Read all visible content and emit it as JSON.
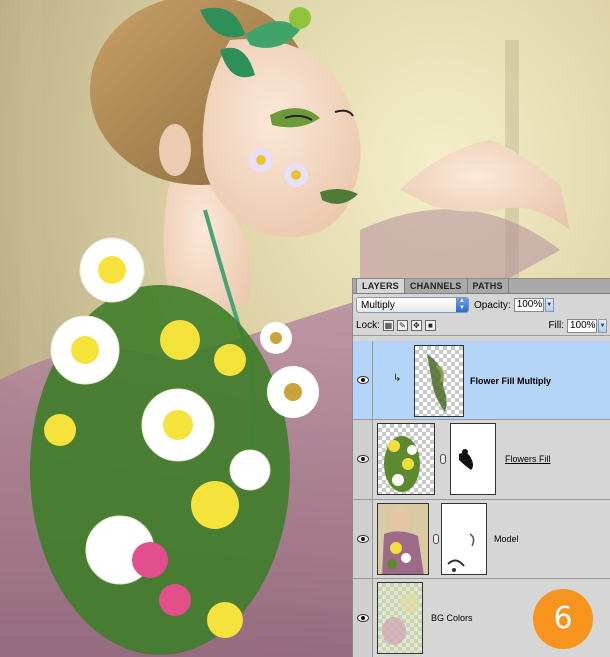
{
  "panel": {
    "tabs": [
      {
        "label": "LAYERS",
        "active": true
      },
      {
        "label": "CHANNELS",
        "active": false
      },
      {
        "label": "PATHS",
        "active": false
      }
    ],
    "blend_mode": "Multiply",
    "opacity_label": "Opacity:",
    "opacity_value": "100%",
    "lock_label": "Lock:",
    "fill_label": "Fill:",
    "fill_value": "100%"
  },
  "layers": [
    {
      "name": "Flower Fill Multiply",
      "selected": true,
      "clipped": true,
      "has_mask": false
    },
    {
      "name": "Flowers Fill",
      "selected": false,
      "clipped": false,
      "has_mask": true
    },
    {
      "name": "Model",
      "selected": false,
      "clipped": false,
      "has_mask": true
    },
    {
      "name": "BG Colors",
      "selected": false,
      "clipped": false,
      "has_mask": false
    }
  ],
  "badge": {
    "step_number": "6"
  },
  "colors": {
    "selection": "#b4d4f8",
    "panel_bg": "#d6d6d6",
    "badge": "#f7941d"
  }
}
